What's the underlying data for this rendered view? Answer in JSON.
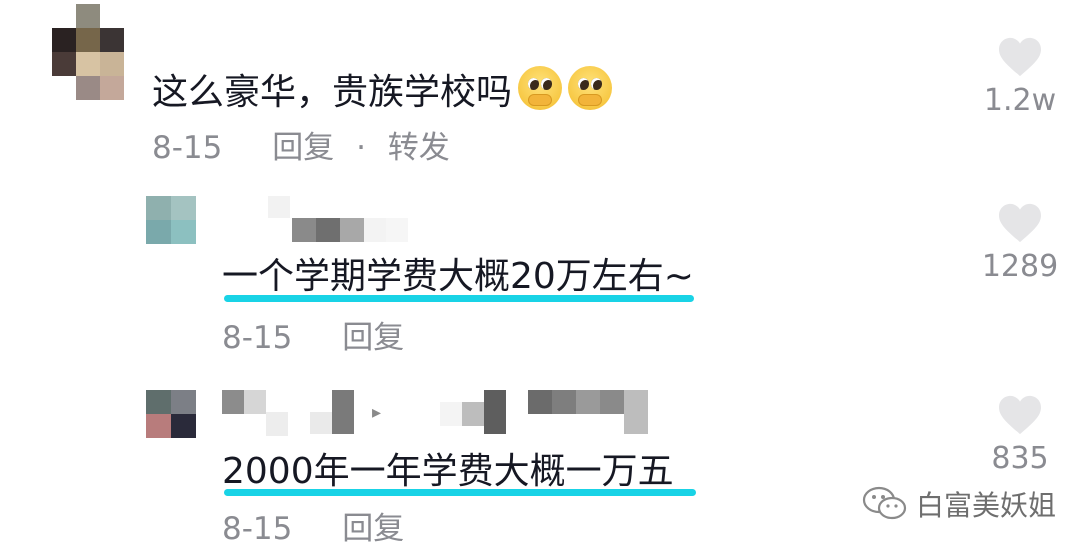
{
  "comments": [
    {
      "text": "这么豪华，贵族学校吗",
      "emojis": [
        "pleading-face-icon",
        "pleading-face-icon"
      ],
      "date": "8-15",
      "reply_label": "回复",
      "separator": "·",
      "forward_label": "转发",
      "likes": "1.2w"
    }
  ],
  "replies": [
    {
      "text": "一个学期学费大概20万左右~",
      "date": "8-15",
      "reply_label": "回复",
      "likes": "1289",
      "highlight_color": "#19d3e6"
    },
    {
      "text": "2000年一年学费大概一万五",
      "date": "8-15",
      "reply_label": "回复",
      "likes": "835",
      "arrow": "▸",
      "highlight_color": "#19d3e6"
    }
  ],
  "watermark": {
    "text": "白富美妖姐",
    "icon": "wechat-icon"
  },
  "colors": {
    "text_primary": "#161823",
    "text_secondary": "#8a8b91",
    "heart": "#e5e5e7",
    "highlight": "#19d3e6"
  }
}
